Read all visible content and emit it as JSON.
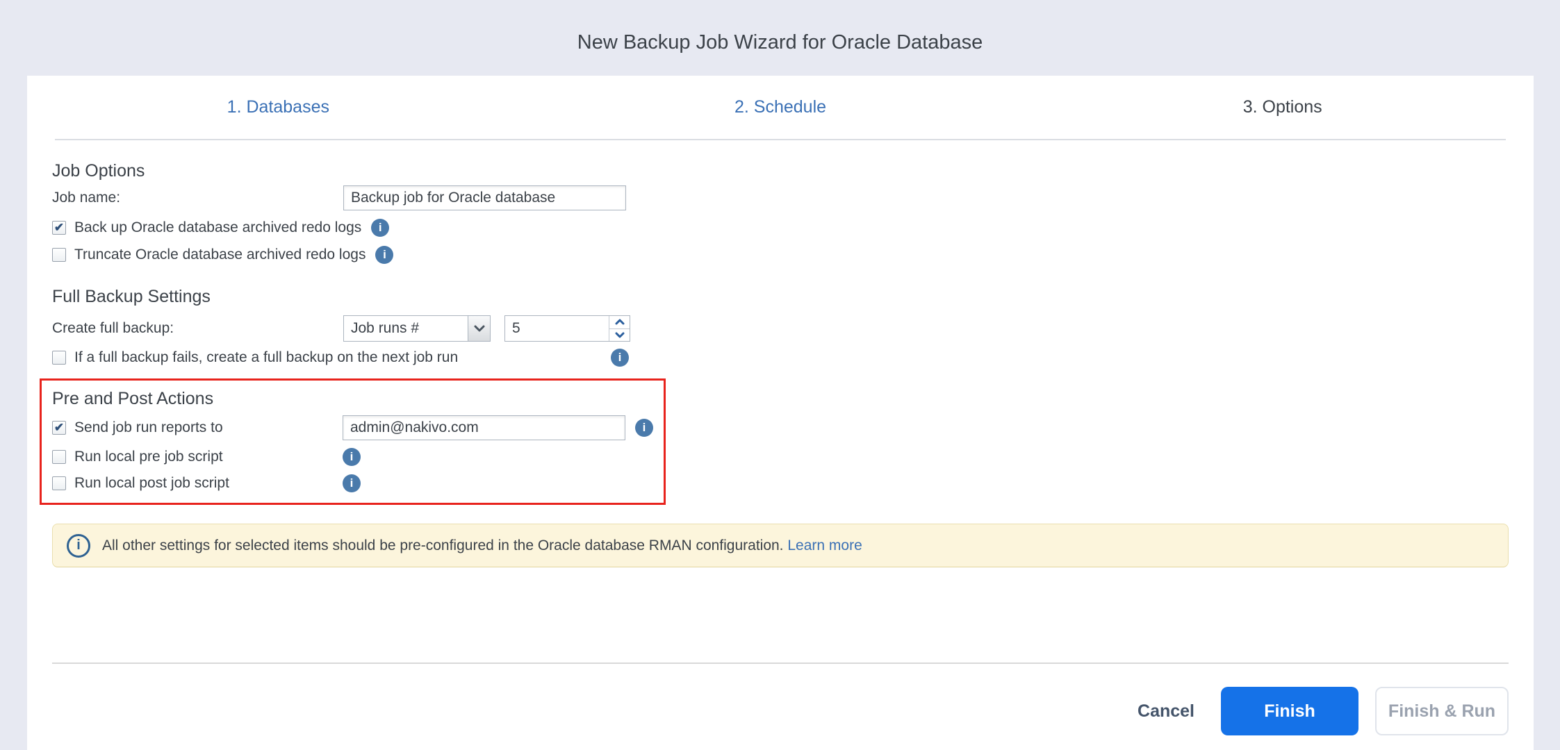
{
  "window": {
    "title": "New Backup Job Wizard for Oracle Database"
  },
  "tabs": [
    {
      "label": "1. Databases",
      "state": "completed-link"
    },
    {
      "label": "2. Schedule",
      "state": "completed-link"
    },
    {
      "label": "3. Options",
      "state": "active"
    }
  ],
  "icons": {
    "info_glyph": "i",
    "banner_info_glyph": "i"
  },
  "job_options": {
    "heading": "Job Options",
    "job_name_label": "Job name:",
    "job_name_value": "Backup job for Oracle database",
    "backup_redo_logs": {
      "label": "Back up Oracle database archived redo logs",
      "checked": true
    },
    "truncate_redo_logs": {
      "label": "Truncate Oracle database archived redo logs",
      "checked": false
    }
  },
  "full_backup": {
    "heading": "Full Backup Settings",
    "create_label": "Create full backup:",
    "mode_selected": "Job runs #",
    "count_value": "5",
    "fail_checkbox": {
      "label": "If a full backup fails, create a full backup on the next job run",
      "checked": false
    }
  },
  "pre_post": {
    "heading": "Pre and Post Actions",
    "send_reports": {
      "label": "Send job run reports to",
      "checked": true,
      "email_value": "admin@nakivo.com"
    },
    "pre_script": {
      "label": "Run local pre job script",
      "checked": false
    },
    "post_script": {
      "label": "Run local post job script",
      "checked": false
    }
  },
  "banner": {
    "text": "All other settings for selected items should be pre-configured in the Oracle database RMAN configuration.",
    "link_label": "Learn more"
  },
  "footer": {
    "cancel_label": "Cancel",
    "finish_label": "Finish",
    "finish_run_label": "Finish & Run"
  },
  "colors": {
    "page_background": "#e7e9f2",
    "accent_blue": "#1572e8",
    "step_link_blue": "#3a70b5",
    "highlight_red": "#e8231d",
    "banner_background": "#fcf5dc",
    "info_icon_blue": "#4a7aab"
  }
}
